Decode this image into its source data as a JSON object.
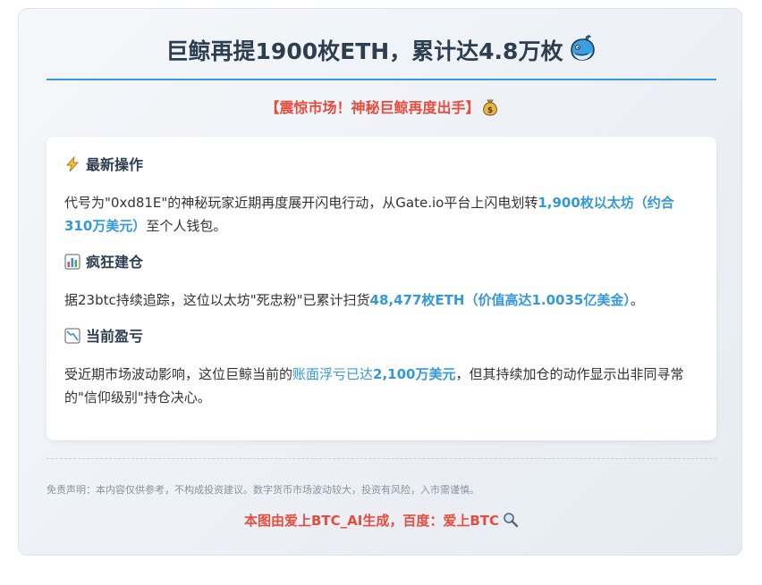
{
  "header": {
    "title": "巨鲸再提1900枚ETH，累计达4.8万枚",
    "title_icon": "whale-icon",
    "subtitle": "【震惊市场！神秘巨鲸再度出手】",
    "subtitle_icon": "money-bag-icon"
  },
  "sections": [
    {
      "icon": "lightning-icon",
      "heading": "最新操作",
      "parts": [
        {
          "text": "代号为\"0xd81E\"的神秘玩家近期再度展开闪电行动，从Gate.io平台上闪电划转",
          "highlight": false
        },
        {
          "text": "1,900枚以太坊（约合310万美元）",
          "highlight": true
        },
        {
          "text": "至个人钱包。",
          "highlight": false
        }
      ]
    },
    {
      "icon": "bar-chart-icon",
      "heading": "疯狂建仓",
      "parts": [
        {
          "text": "据23btc持续追踪，这位以太坊\"死忠粉\"已累计扫货",
          "highlight": false
        },
        {
          "text": "48,477枚ETH（价值高达1.0035亿美金）",
          "highlight": true
        },
        {
          "text": "。",
          "highlight": false
        }
      ]
    },
    {
      "icon": "chart-decreasing-icon",
      "heading": "当前盈亏",
      "parts": [
        {
          "text": "受近期市场波动影响，这位巨鲸当前的",
          "highlight": false
        },
        {
          "text": "账面浮亏已达",
          "highlight": "soft"
        },
        {
          "text": "2,100万美元",
          "highlight": true
        },
        {
          "text": "，但其持续加仓的动作显示出非同寻常的\"信仰级别\"持仓决心。",
          "highlight": false
        }
      ]
    }
  ],
  "footer": {
    "disclaimer": "免责声明：本内容仅供参考，不构成投资建议。数字货币市场波动较大，投资有风险，入市需谨慎。",
    "credit": "本图由爱上BTC_AI生成，百度：爱上BTC",
    "credit_icon": "magnifier-icon"
  },
  "colors": {
    "title": "#2c3e50",
    "accent": "#3498db",
    "alert": "#e74c3c",
    "body_text": "#333333",
    "muted": "#8a939c"
  }
}
